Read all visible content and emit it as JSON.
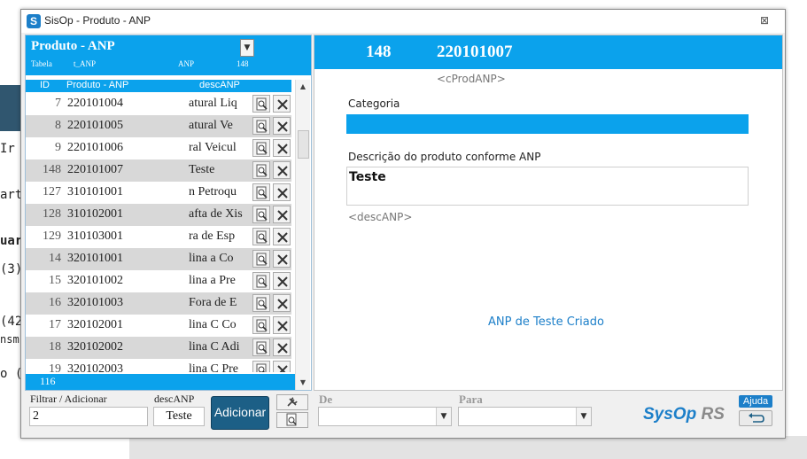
{
  "window": {
    "title": "SisOp - Produto - ANP",
    "close_glyph": "⊠"
  },
  "background": {
    "fragments": [
      "uar",
      "(3)",
      "(42",
      "nsm",
      "o (",
      "arta",
      "Ir"
    ]
  },
  "left_panel": {
    "title": "Produto - ANP",
    "sub_tabela": "Tabela",
    "sub_table_name": "t_ANP",
    "sub_field": "ANP",
    "sub_count": "148",
    "columns": {
      "id": "ID",
      "code": "Produto - ANP",
      "desc": "descANP"
    },
    "rows": [
      {
        "id": "7",
        "code": "220101004",
        "desc": "atural Liq"
      },
      {
        "id": "8",
        "code": "220101005",
        "desc": "atural Ve"
      },
      {
        "id": "9",
        "code": "220101006",
        "desc": "ral Veicul"
      },
      {
        "id": "148",
        "code": "220101007",
        "desc": "Teste"
      },
      {
        "id": "127",
        "code": "310101001",
        "desc": "n Petroqu"
      },
      {
        "id": "128",
        "code": "310102001",
        "desc": "afta de Xis"
      },
      {
        "id": "129",
        "code": "310103001",
        "desc": "ra de Esp"
      },
      {
        "id": "14",
        "code": "320101001",
        "desc": "lina a Co"
      },
      {
        "id": "15",
        "code": "320101002",
        "desc": "lina a Pre"
      },
      {
        "id": "16",
        "code": "320101003",
        "desc": "Fora de E"
      },
      {
        "id": "17",
        "code": "320102001",
        "desc": "lina C Co"
      },
      {
        "id": "18",
        "code": "320102002",
        "desc": "lina C Adi"
      },
      {
        "id": "19",
        "code": "320102003",
        "desc": "lina C Pre"
      }
    ],
    "footer_count": "116"
  },
  "right_panel": {
    "id": "148",
    "code": "220101007",
    "code_tag": "<cProdANP>",
    "category_label": "Categoria",
    "category_value": "",
    "desc_label": "Descrição do produto conforme ANP",
    "desc_value": "Teste",
    "desc_tag": "<descANP>",
    "status_message": "ANP de Teste Criado"
  },
  "bottom_bar": {
    "filter_label": "Filtrar / Adicionar",
    "filter_value": "2",
    "desc_label": "descANP",
    "desc_value": "Teste",
    "add_button": "Adicionar",
    "from_label": "De",
    "to_label": "Para",
    "brand_main": "SysOp",
    "brand_suffix": "RS",
    "help_button": "Ajuda"
  },
  "colors": {
    "accent": "#0ba2ec",
    "button_dark": "#1c5f86",
    "link": "#1c7fc9"
  }
}
